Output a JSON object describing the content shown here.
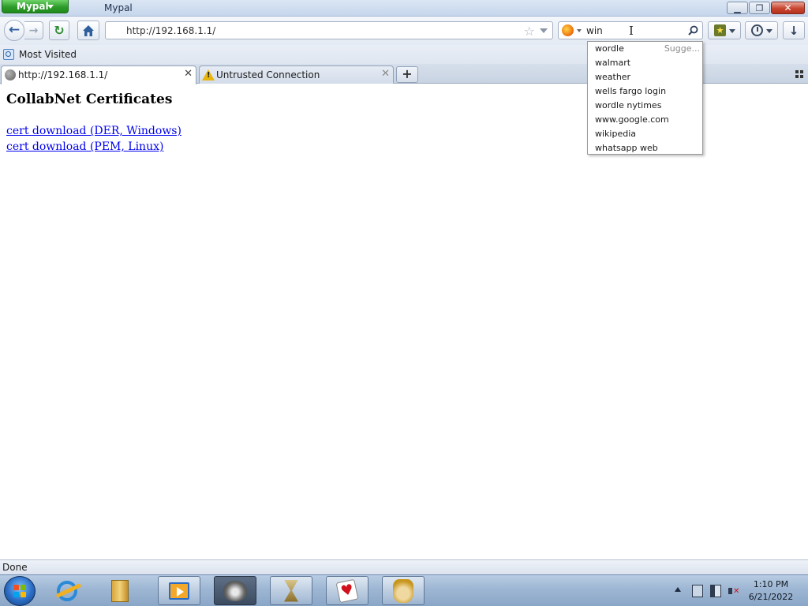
{
  "window": {
    "app_button_label": "Mypal",
    "title": "Mypal",
    "controls": {
      "minimize_glyph": "▁",
      "maximize_glyph": "❐",
      "close_glyph": "✕"
    }
  },
  "navbar": {
    "url": "http://192.168.1.1/",
    "search_value": "win",
    "icons": [
      "back-arrow-icon",
      "forward-arrow-icon",
      "reload-icon",
      "home-icon",
      "star-icon",
      "search-engine-icon",
      "magnifier-icon",
      "bookmarks-star-icon",
      "history-clock-icon",
      "download-arrow-icon"
    ]
  },
  "bookmarks_bar": {
    "items": [
      {
        "label": "Most Visited"
      }
    ]
  },
  "tabs": [
    {
      "label": "http://192.168.1.1/",
      "active": true
    },
    {
      "label": "Untrusted Connection",
      "active": false
    }
  ],
  "content": {
    "heading": "CollabNet Certificates",
    "links": [
      {
        "label": "cert download (DER, Windows)"
      },
      {
        "label": "cert download (PEM, Linux)"
      }
    ]
  },
  "search_suggestions": {
    "header": "Sugge...",
    "items": [
      "wordle",
      "walmart",
      "weather",
      "wells fargo login",
      "wordle nytimes",
      "www.google.com",
      "wikipedia",
      "whatsapp web"
    ]
  },
  "status_bar": {
    "text": "Done"
  },
  "taskbar": {
    "pinned": [
      "internet-explorer-icon",
      "windows-explorer-icon",
      "media-player-icon",
      "raccoon-app-icon",
      "hourglass-app-icon",
      "hearts-game-icon",
      "solitaire-king-icon"
    ],
    "clock": {
      "time": "1:10 PM",
      "date": "6/21/2022"
    }
  },
  "colors": {
    "link": "#0000ee",
    "app_button": "#2e9c2a",
    "close_button": "#c8452f",
    "taskbar": "#9db6d3"
  }
}
